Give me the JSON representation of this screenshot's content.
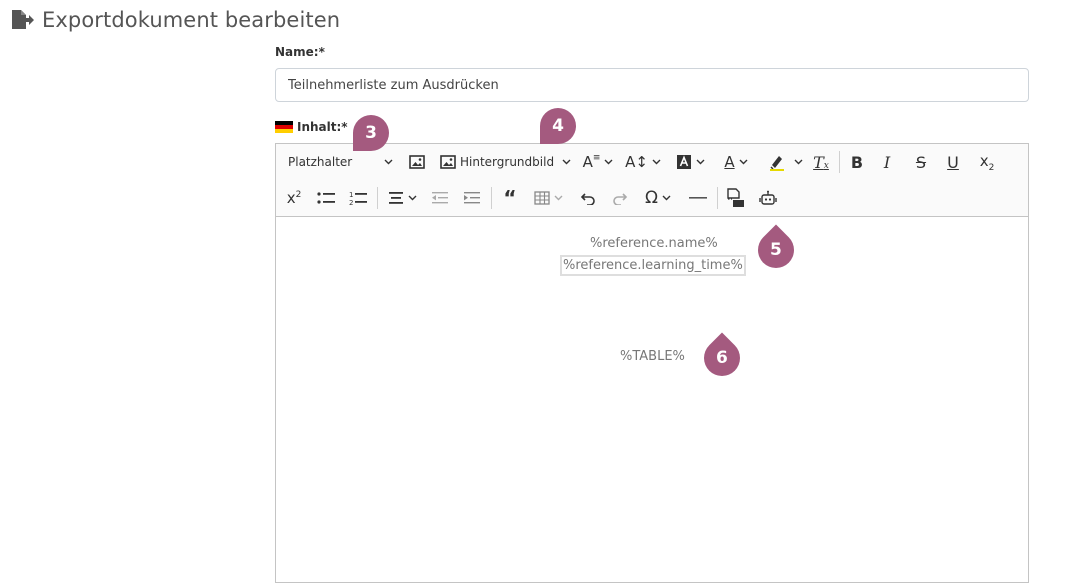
{
  "page": {
    "title": "Exportdokument bearbeiten"
  },
  "form": {
    "name_label": "Name:*",
    "name_value": "Teilnehmerliste zum Ausdrücken",
    "content_label": "Inhalt:*"
  },
  "toolbar": {
    "placeholder_dropdown": "Platzhalter",
    "background_image_label": "Hintergrundbild"
  },
  "editor": {
    "line1": "%reference.name%",
    "line2": "%reference.learning_time%",
    "table": "%TABLE%"
  },
  "markers": [
    "3",
    "4",
    "5",
    "6"
  ],
  "colors": {
    "marker": "#a45a7f",
    "flag_black": "#000000",
    "flag_red": "#dd0000",
    "flag_gold": "#ffce00"
  }
}
